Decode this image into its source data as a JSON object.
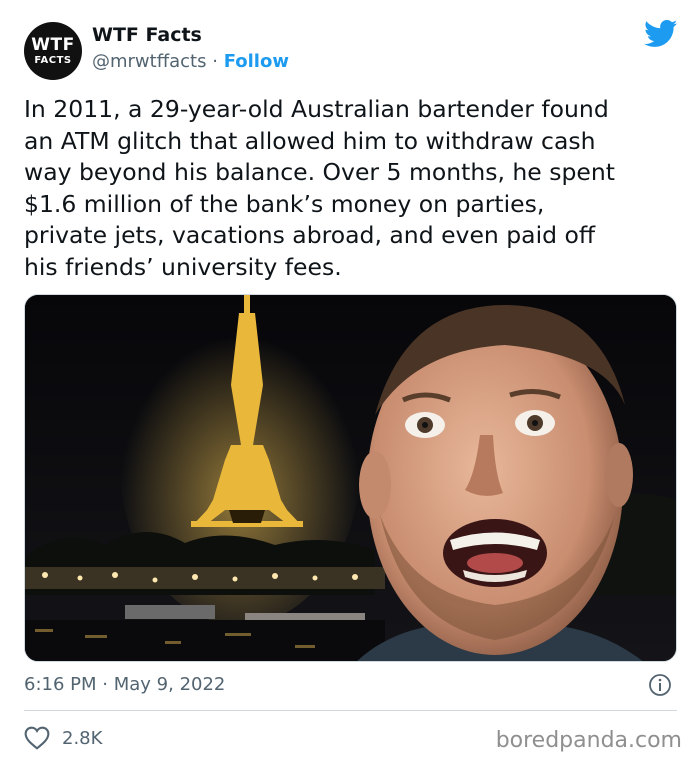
{
  "tweet": {
    "author_name": "WTF Facts",
    "handle": "@mrwtffacts",
    "separator": "·",
    "follow_label": "Follow",
    "avatar_logo": {
      "line1": "WTF",
      "line2": "FACTS"
    },
    "text": "In 2011, a 29-year-old Australian bartender found\nan ATM glitch that allowed him to withdraw cash\nway beyond his balance. Over 5 months, he spent\n$1.6 million of the bank’s money on parties,\nprivate jets, vacations abroad, and even paid off\nhis friends’ university fees.",
    "time": "6:16 PM",
    "date_separator": "·",
    "date": "May 9, 2022",
    "like_count": "2.8K"
  },
  "icons": {
    "platform": "twitter-bird-icon",
    "info": "info-icon",
    "like": "heart-icon"
  },
  "colors": {
    "brand_blue": "#1d9bf0",
    "text_primary": "#0f1419",
    "text_secondary": "#536471",
    "divider": "#cfd9de",
    "watermark": "#8f8f8f"
  },
  "watermark": "boredpanda.com"
}
